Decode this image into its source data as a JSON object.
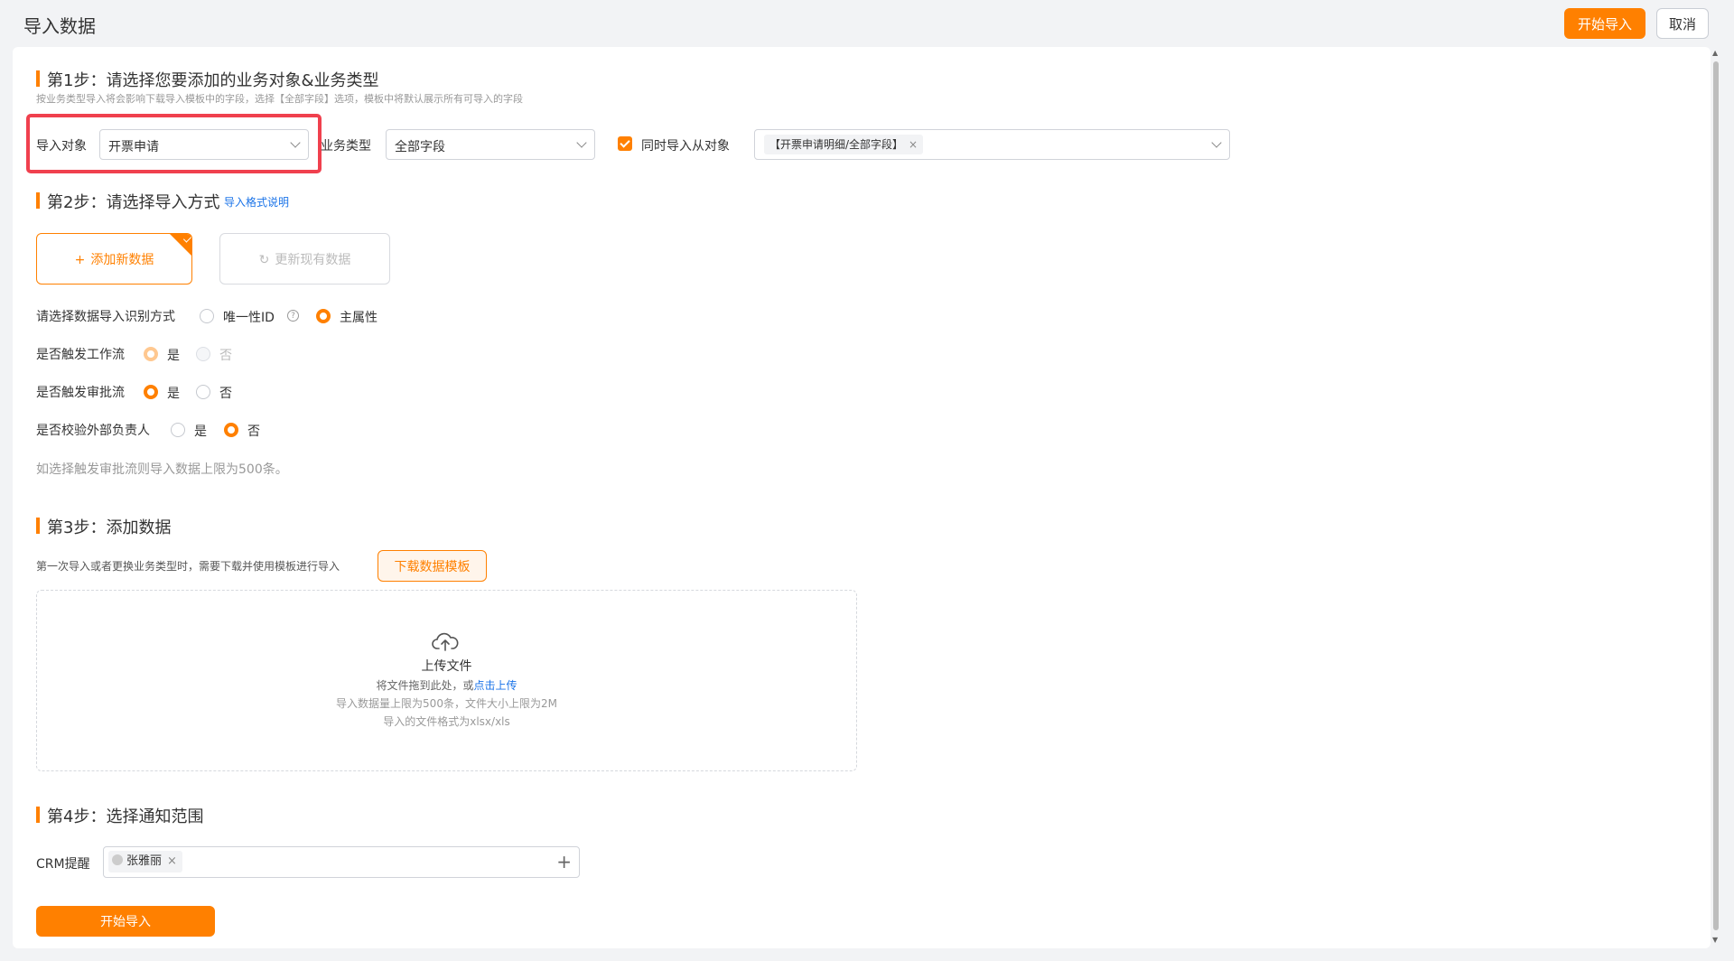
{
  "header": {
    "title": "导入数据",
    "start_button": "开始导入",
    "cancel_button": "取消"
  },
  "step1": {
    "title": "第1步：请选择您要添加的业务对象&业务类型",
    "hint": "按业务类型导入将会影响下载导入模板中的字段，选择【全部字段】选项，模板中将默认展示所有可导入的字段",
    "object_label": "导入对象",
    "object_value": "开票申请",
    "type_label": "业务类型",
    "type_value": "全部字段",
    "sub_checkbox_label": "同时导入从对象",
    "sub_checked": true,
    "sub_tag": "【开票申请明细/全部字段】",
    "tag_close": "×"
  },
  "step2": {
    "title": "第2步：请选择导入方式",
    "format_link": "导入格式说明",
    "add_new": "添加新数据",
    "update_existing": "更新现有数据",
    "identify_label": "请选择数据导入识别方式",
    "identify_opt1": "唯一性ID",
    "identify_opt2": "主属性",
    "workflow_label": "是否触发工作流",
    "approval_label": "是否触发审批流",
    "external_label": "是否校验外部负责人",
    "yes": "是",
    "no": "否",
    "note": "如选择触发审批流则导入数据上限为500条。"
  },
  "step3": {
    "title": "第3步：添加数据",
    "hint": "第一次导入或者更换业务类型时，需要下载并使用模板进行导入",
    "download_button": "下载数据模板",
    "upload_title": "上传文件",
    "drag_text": "将文件拖到此处，或",
    "click_upload": "点击上传",
    "limit_text": "导入数据量上限为500条，文件大小上限为2M",
    "format_text": "导入的文件格式为xlsx/xls"
  },
  "step4": {
    "title": "第4步：选择通知范围",
    "crm_label": "CRM提醒",
    "person": "张雅丽",
    "person_close": "×",
    "add_icon": "+"
  },
  "bottom_button": "开始导入",
  "colors": {
    "accent": "#ff8000",
    "highlight_box": "#f0404e",
    "link": "#1a73e8"
  }
}
